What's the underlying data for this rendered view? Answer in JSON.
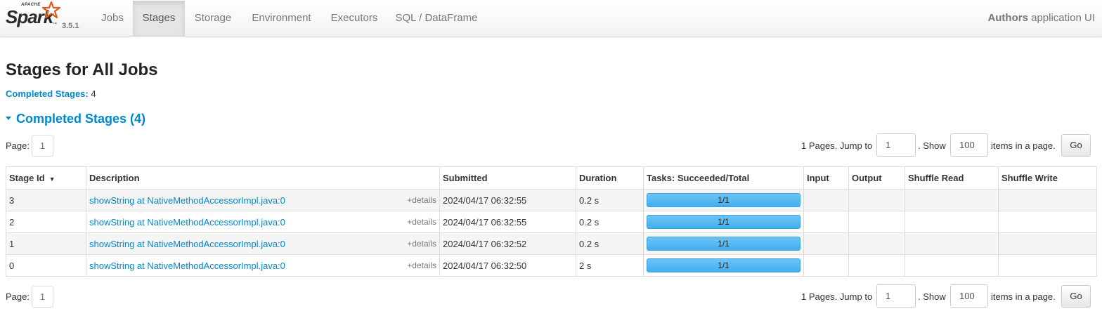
{
  "navbar": {
    "apache_label": "APACHE",
    "brand": "Spark",
    "trademark": "™",
    "version": "3.5.1",
    "tabs": [
      {
        "label": "Jobs",
        "active": false
      },
      {
        "label": "Stages",
        "active": true
      },
      {
        "label": "Storage",
        "active": false
      },
      {
        "label": "Environment",
        "active": false
      },
      {
        "label": "Executors",
        "active": false
      },
      {
        "label": "SQL / DataFrame",
        "active": false
      }
    ],
    "app_name": "Authors",
    "app_suffix": "application UI"
  },
  "page_title": "Stages for All Jobs",
  "summary": {
    "label": "Completed Stages:",
    "value": "4"
  },
  "section": {
    "title": "Completed Stages (4)"
  },
  "pager": {
    "page_label": "Page:",
    "page_number": "1",
    "pages_text": "1 Pages. Jump to",
    "jump_value": "1",
    "show_label": ". Show",
    "show_value": "100",
    "items_text": "items in a page.",
    "go_label": "Go"
  },
  "table": {
    "sort_indicator": "▼",
    "columns": [
      "Stage Id",
      "Description",
      "Submitted",
      "Duration",
      "Tasks: Succeeded/Total",
      "Input",
      "Output",
      "Shuffle Read",
      "Shuffle Write"
    ],
    "details_label": "+details",
    "rows": [
      {
        "stage_id": "3",
        "description": "showString at NativeMethodAccessorImpl.java:0",
        "submitted": "2024/04/17 06:32:55",
        "duration": "0.2 s",
        "tasks": "1/1",
        "tasks_fraction": 1.0,
        "input": "",
        "output": "",
        "shuffle_read": "",
        "shuffle_write": ""
      },
      {
        "stage_id": "2",
        "description": "showString at NativeMethodAccessorImpl.java:0",
        "submitted": "2024/04/17 06:32:55",
        "duration": "0.2 s",
        "tasks": "1/1",
        "tasks_fraction": 1.0,
        "input": "",
        "output": "",
        "shuffle_read": "",
        "shuffle_write": ""
      },
      {
        "stage_id": "1",
        "description": "showString at NativeMethodAccessorImpl.java:0",
        "submitted": "2024/04/17 06:32:52",
        "duration": "0.2 s",
        "tasks": "1/1",
        "tasks_fraction": 1.0,
        "input": "",
        "output": "",
        "shuffle_read": "",
        "shuffle_write": ""
      },
      {
        "stage_id": "0",
        "description": "showString at NativeMethodAccessorImpl.java:0",
        "submitted": "2024/04/17 06:32:50",
        "duration": "2 s",
        "tasks": "1/1",
        "tasks_fraction": 1.0,
        "input": "",
        "output": "",
        "shuffle_read": "",
        "shuffle_write": ""
      }
    ]
  },
  "colors": {
    "link": "#0088cc",
    "progress": "#42aef0",
    "spark_orange": "#e25a1c"
  }
}
